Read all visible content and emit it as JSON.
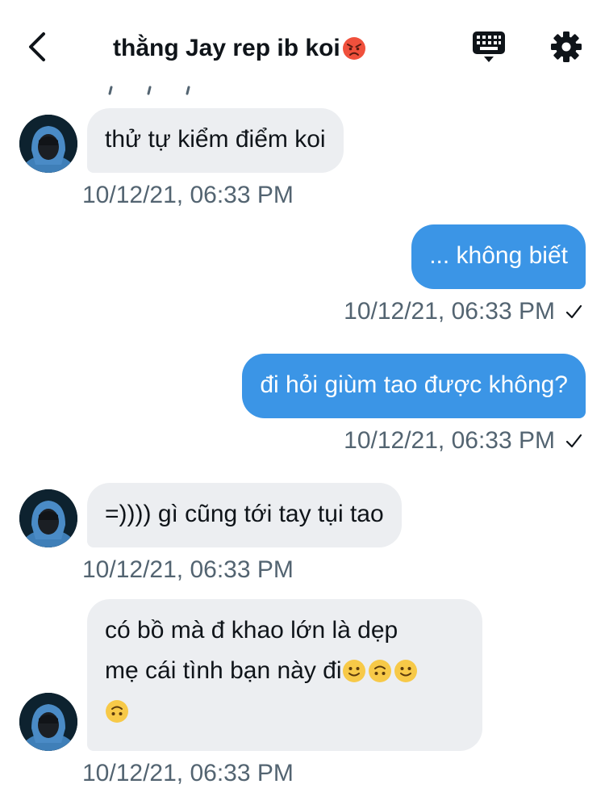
{
  "header": {
    "title": "thằng Jay rep ib koi",
    "title_emoji": "angry-face-emoji"
  },
  "icons": {
    "back": "chevron-left-icon",
    "keyboard": "keyboard-icon",
    "settings": "gear-icon"
  },
  "colors": {
    "outgoing_bubble": "#3b95e6",
    "incoming_bubble": "#eceef1",
    "timestamp": "#536471",
    "text": "#0f1419"
  },
  "messages": [
    {
      "direction": "in",
      "text": "thử tự kiểm điểm koi",
      "time": "10/12/21, 06:33 PM"
    },
    {
      "direction": "out",
      "text": "... không biết",
      "time": "10/12/21, 06:33 PM",
      "read": true
    },
    {
      "direction": "out",
      "text": "đi hỏi giùm tao được không?",
      "time": "10/12/21, 06:33 PM",
      "read": true
    },
    {
      "direction": "in",
      "text": "=)))) gì cũng tới tay tụi tao",
      "time": "10/12/21, 06:33 PM"
    },
    {
      "direction": "in",
      "line1": "có bồ mà đ khao lớn là dẹp",
      "line2": "mẹ cái tình bạn này đi",
      "emojis": [
        "slightly-smiling-face",
        "upside-down-face",
        "slightly-smiling-face",
        "upside-down-face"
      ],
      "time": "10/12/21, 06:33 PM"
    }
  ]
}
